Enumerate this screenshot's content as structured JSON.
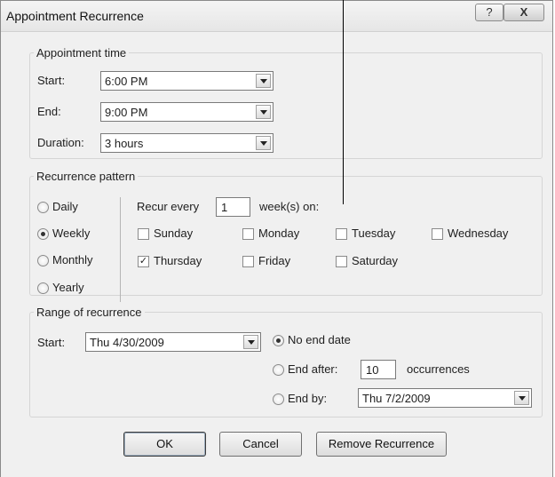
{
  "window": {
    "title": "Appointment Recurrence",
    "help_label": "?",
    "close_label": "X"
  },
  "appointment_time": {
    "legend": "Appointment time",
    "start_label": "Start:",
    "start_value": "6:00 PM",
    "end_label": "End:",
    "end_value": "9:00 PM",
    "duration_label": "Duration:",
    "duration_value": "3 hours"
  },
  "recurrence_pattern": {
    "legend": "Recurrence pattern",
    "frequency_options": [
      {
        "label": "Daily",
        "selected": false
      },
      {
        "label": "Weekly",
        "selected": true
      },
      {
        "label": "Monthly",
        "selected": false
      },
      {
        "label": "Yearly",
        "selected": false
      }
    ],
    "recur_every_label": "Recur every",
    "recur_every_value": "1",
    "weeks_on_label": "week(s) on:",
    "days": [
      {
        "label": "Sunday",
        "checked": false
      },
      {
        "label": "Monday",
        "checked": false
      },
      {
        "label": "Tuesday",
        "checked": false
      },
      {
        "label": "Wednesday",
        "checked": false
      },
      {
        "label": "Thursday",
        "checked": true
      },
      {
        "label": "Friday",
        "checked": false
      },
      {
        "label": "Saturday",
        "checked": false
      }
    ]
  },
  "range": {
    "legend": "Range of recurrence",
    "start_label": "Start:",
    "start_value": "Thu 4/30/2009",
    "no_end_label": "No end date",
    "end_after_label": "End after:",
    "end_after_value": "10",
    "occurrences_label": "occurrences",
    "end_by_label": "End by:",
    "end_by_value": "Thu 7/2/2009",
    "selected": "no_end"
  },
  "buttons": {
    "ok": "OK",
    "cancel": "Cancel",
    "remove": "Remove Recurrence"
  }
}
